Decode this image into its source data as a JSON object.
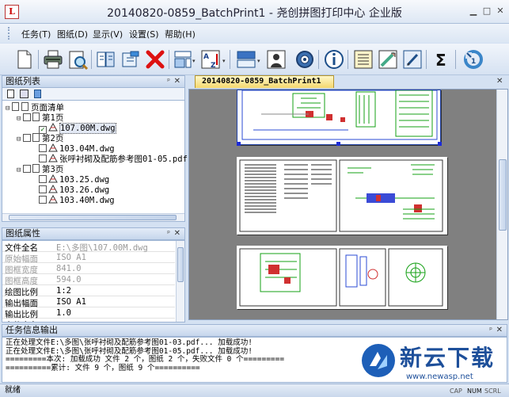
{
  "window": {
    "title": "20140820-0859_BatchPrint1 - 尧创拼图打印中心 企业版",
    "app_icon_text": "L",
    "min_glyph": "▁",
    "max_glyph": "□",
    "close_glyph": "✕"
  },
  "menu": [
    "任务(T)",
    "图纸(D)",
    "显示(V)",
    "设置(S)",
    "帮助(H)"
  ],
  "toolbar": {
    "buttons": [
      "new-doc",
      "print",
      "print-preview",
      "copy-pages",
      "open-folder",
      "delete",
      "layout",
      "sort-az",
      "arrange",
      "stamp",
      "settings-gear",
      "info",
      "list-view",
      "check-edit",
      "pen-edit",
      "sigma-sum",
      "refresh"
    ],
    "sort_label": "AZ",
    "sigma_label": "Σ",
    "info_label": "i"
  },
  "left_panel": {
    "title": "图纸列表",
    "pin": "ᵖ",
    "close": "✕",
    "tree": [
      {
        "label": "页面清单",
        "type": "root",
        "expander": "⊟"
      },
      {
        "label": "第1页",
        "type": "page",
        "expander": "⊟"
      },
      {
        "label": "107.00M.dwg",
        "type": "file",
        "checked": true,
        "selected": true
      },
      {
        "label": "第2页",
        "type": "page",
        "expander": "⊟"
      },
      {
        "label": "103.04M.dwg",
        "type": "file"
      },
      {
        "label": "张呼衬砌及配筋参考图01-05.pdf",
        "type": "file"
      },
      {
        "label": "第3页",
        "type": "page",
        "expander": "⊟"
      },
      {
        "label": "103.25.dwg",
        "type": "file"
      },
      {
        "label": "103.26.dwg",
        "type": "file"
      },
      {
        "label": "103.40M.dwg",
        "type": "file"
      }
    ],
    "check_glyph": "✓"
  },
  "props_panel": {
    "title": "图纸属性",
    "rows": [
      {
        "key": "文件全名",
        "value": "E:\\多图\\107.00M.dwg",
        "dim": false,
        "valdim": true
      },
      {
        "key": "原始幅面",
        "value": "ISO A1",
        "dim": true
      },
      {
        "key": "图框宽度",
        "value": "841.0",
        "dim": true
      },
      {
        "key": "图框高度",
        "value": "594.0",
        "dim": true
      },
      {
        "key": "绘图比例",
        "value": "1:2",
        "dim": false
      },
      {
        "key": "输出幅面",
        "value": "ISO A1",
        "dim": false
      },
      {
        "key": "输出比例",
        "value": "1.0",
        "dim": false
      },
      {
        "key": "文件全名",
        "value": "",
        "dim": false
      }
    ]
  },
  "document": {
    "tab_label": "20140820-0859_BatchPrint1",
    "tab_close": "✕"
  },
  "output": {
    "title": "任务信息输出",
    "lines": [
      "正在处理文件E:\\多图\\张呼衬砌及配筋参考图01-03.pdf... 加载成功!",
      "正在处理文件E:\\多图\\张呼衬砌及配筋参考图01-05.pdf... 加载成功!",
      "=========本次: 加载成功 文件 2 个，图纸 2 个，失败文件 0 个=========",
      "==========累计: 文件 9 个，图纸 9 个=========="
    ]
  },
  "status": {
    "text": "就绪",
    "indicators": [
      "CAP",
      "NUM",
      "SCRL"
    ]
  },
  "watermark": {
    "brand": "新云下载",
    "url": "www.newasp.net"
  }
}
